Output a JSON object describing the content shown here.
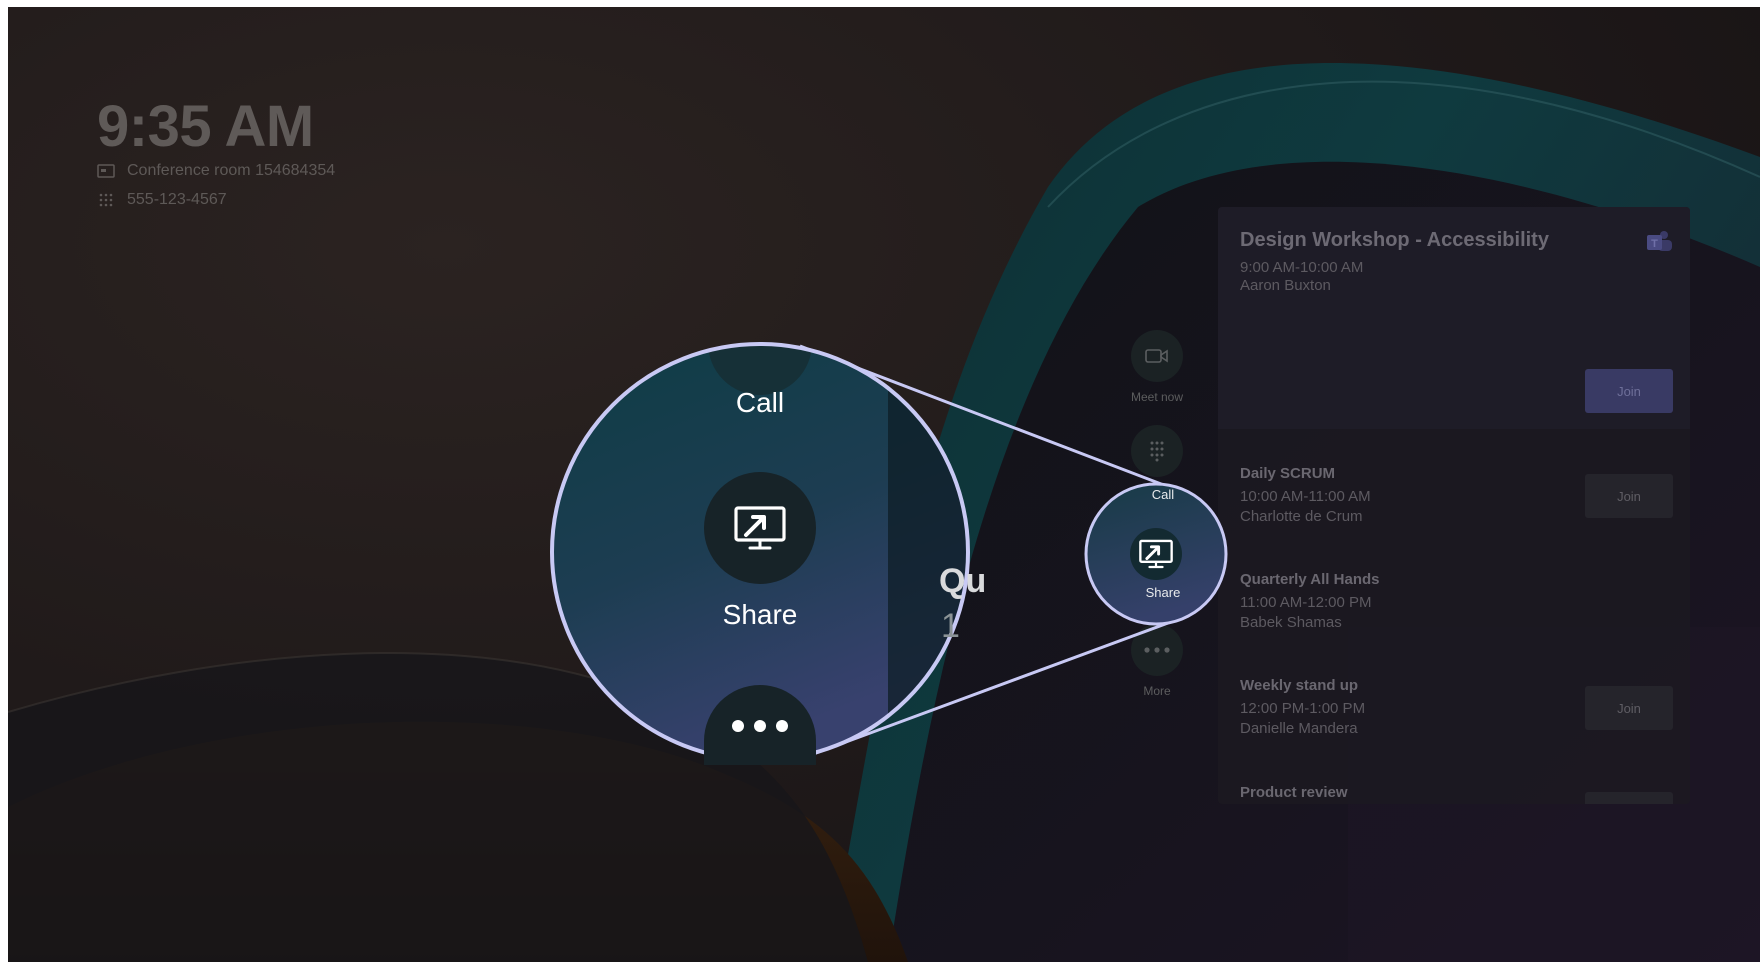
{
  "home": {
    "time": "9:35 AM",
    "room_name": "Conference room 154684354",
    "phone": "555-123-4567"
  },
  "rail": {
    "meet_now_label": "Meet now",
    "call_label": "Call",
    "share_label": "Share",
    "more_label": "More"
  },
  "magnifier": {
    "call_label": "Call",
    "share_label": "Share",
    "peek_title": "Qu",
    "peek_time": "1"
  },
  "meetings": [
    {
      "title": "Design Workshop - Accessibility",
      "time": "9:00 AM-10:00 AM",
      "organizer": "Aaron Buxton",
      "join": "Join"
    },
    {
      "title": "Daily SCRUM",
      "time": "10:00 AM-11:00 AM",
      "organizer": "Charlotte de Crum",
      "join": "Join"
    },
    {
      "title": "Quarterly All Hands",
      "time": "11:00 AM-12:00 PM",
      "organizer": "Babek Shamas"
    },
    {
      "title": "Weekly stand up",
      "time": "12:00 PM-1:00 PM",
      "organizer": "Danielle Mandera",
      "join": "Join"
    },
    {
      "title": "Product review"
    }
  ],
  "colors": {
    "background": "#241d1c",
    "accent_ring": "#c8c9f4",
    "join_primary": "#393a64"
  },
  "icons": {
    "room": "room-display-icon",
    "phone": "dialpad-icon",
    "meet_now": "video-camera-icon",
    "call": "dialpad-icon",
    "share": "share-screen-icon",
    "more": "more-dots-icon",
    "app": "teams-icon"
  }
}
